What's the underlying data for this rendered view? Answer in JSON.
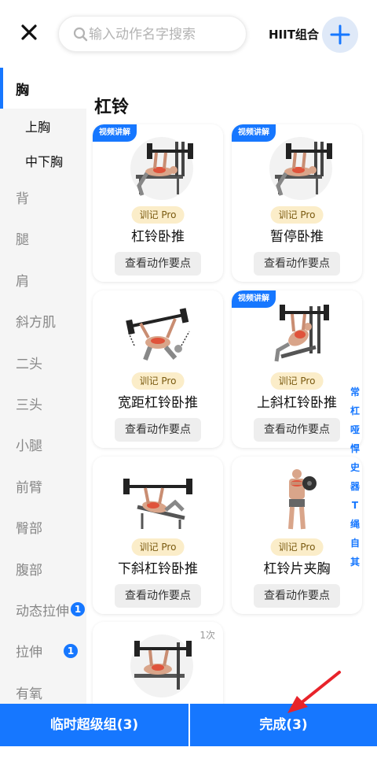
{
  "header": {
    "search_placeholder": "输入动作名字搜索",
    "hiit_label": "HIIT组合"
  },
  "sidebar": {
    "categories": [
      {
        "label": "胸",
        "active": true
      },
      {
        "label": "背"
      },
      {
        "label": "腿"
      },
      {
        "label": "肩"
      },
      {
        "label": "斜方肌"
      },
      {
        "label": "二头"
      },
      {
        "label": "三头"
      },
      {
        "label": "小腿"
      },
      {
        "label": "前臂"
      },
      {
        "label": "臀部"
      },
      {
        "label": "腹部"
      },
      {
        "label": "动态拉伸",
        "badge": "1"
      },
      {
        "label": "拉伸",
        "badge": "1"
      },
      {
        "label": "有氧"
      }
    ],
    "subcategories": [
      "上胸",
      "中下胸"
    ]
  },
  "main": {
    "section_title": "杠铃",
    "video_tag": "视频讲解",
    "pro_label": "训记 Pro",
    "keypoints_label": "查看动作要点",
    "exercises": [
      {
        "name": "杠铃卧推",
        "video": true
      },
      {
        "name": "暂停卧推",
        "video": true
      },
      {
        "name": "宽距杠铃卧推",
        "video": false
      },
      {
        "name": "上斜杠铃卧推",
        "video": true
      },
      {
        "name": "下斜杠铃卧推",
        "video": false
      },
      {
        "name": "杠铃片夹胸",
        "video": false
      },
      {
        "name": "",
        "count": "1次"
      }
    ]
  },
  "index": [
    "常",
    "杠",
    "哑",
    "悍",
    "史",
    "器",
    "T",
    "绳",
    "自",
    "其"
  ],
  "footer": {
    "superset_label": "临时超级组(3)",
    "done_label": "完成(3)"
  },
  "colors": {
    "accent": "#1677ff",
    "pro_bg": "#fbedc9",
    "arrow": "#e8232a"
  }
}
